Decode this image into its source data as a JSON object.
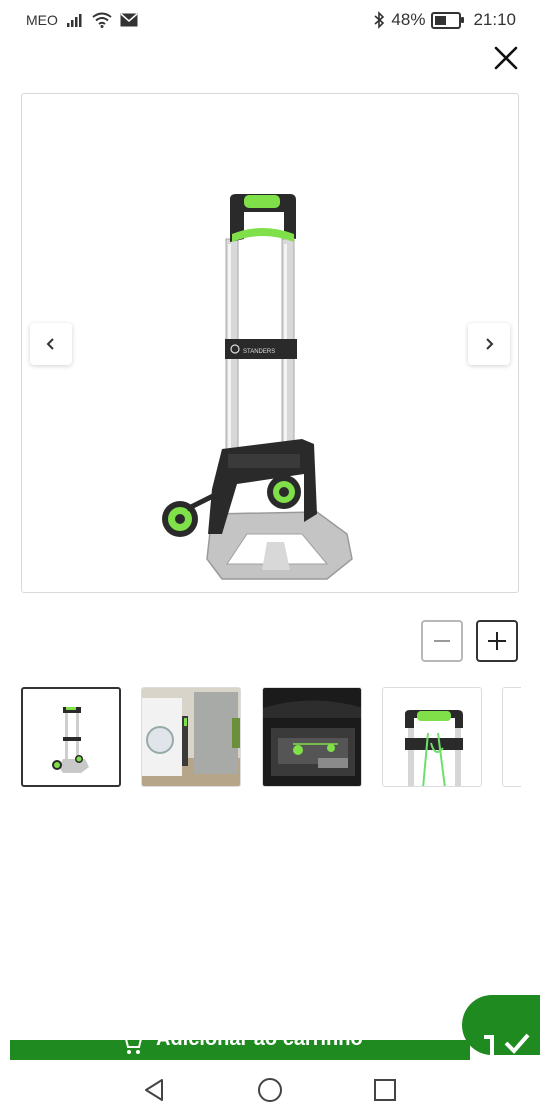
{
  "status_bar": {
    "carrier": "MEO",
    "battery_percent": "48%",
    "battery_level": 0.48,
    "time": "21:10",
    "icons": [
      "signal-icon",
      "wifi-icon",
      "mail-icon",
      "bluetooth-icon",
      "battery-icon"
    ]
  },
  "gallery": {
    "close_icon": "close-icon",
    "prev_icon": "chevron-left-icon",
    "next_icon": "chevron-right-icon",
    "product_brand_mark": "STANDERS",
    "zoom_out_icon": "minus-icon",
    "zoom_in_icon": "plus-icon",
    "thumbnails": [
      {
        "name": "thumbnail-trolley",
        "active": true
      },
      {
        "name": "thumbnail-laundry-room",
        "active": false
      },
      {
        "name": "thumbnail-car-trunk",
        "active": false
      },
      {
        "name": "thumbnail-handle-detail",
        "active": false
      },
      {
        "name": "thumbnail-extra",
        "active": false
      }
    ]
  },
  "bottom_action": {
    "add_to_cart_label": "Adicionar ao carrinho",
    "cart_icon": "cart-icon",
    "check_icon": "check-icon"
  },
  "system_nav": {
    "icons": [
      "back-icon",
      "home-icon",
      "recents-icon"
    ]
  },
  "colors": {
    "accent_green": "#1f8a1f",
    "lime_green": "#7fe04a",
    "frame_dark": "#2a2a2a"
  }
}
